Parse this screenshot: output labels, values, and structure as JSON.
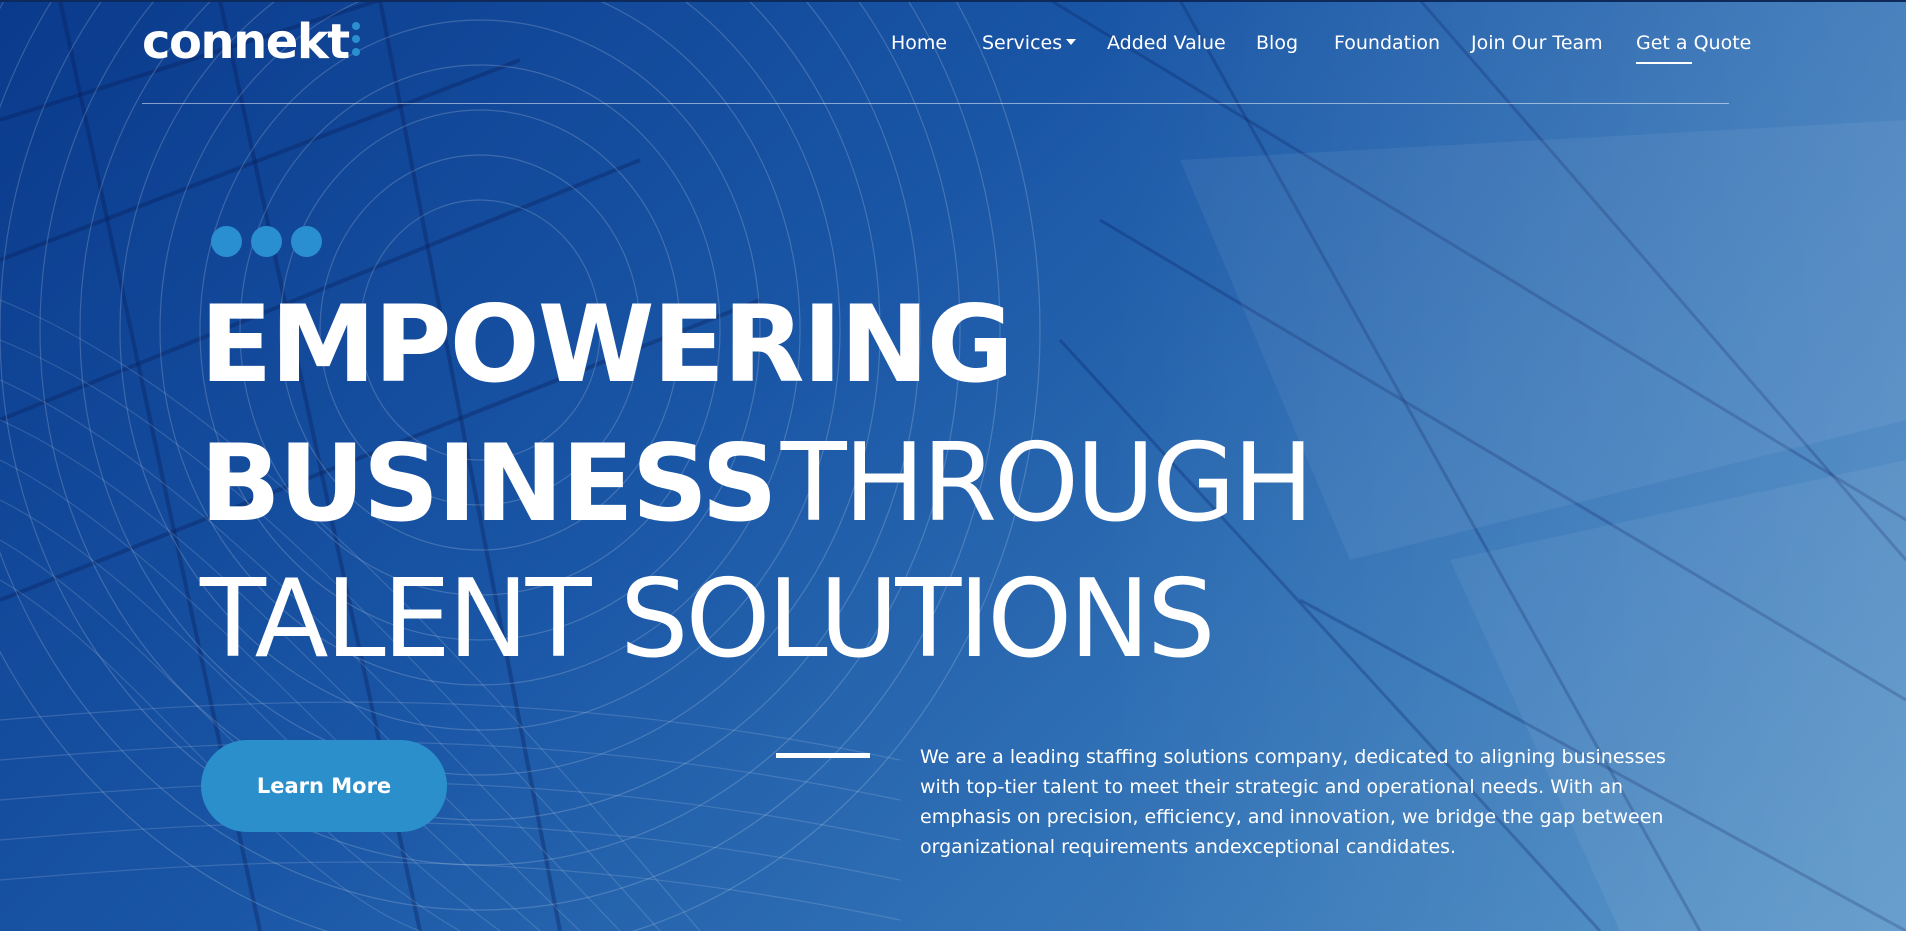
{
  "header": {
    "logo_text": "connekt",
    "nav": [
      {
        "label": "Home"
      },
      {
        "label": "Services"
      },
      {
        "label": "Added Value"
      },
      {
        "label": "Blog"
      },
      {
        "label": "Foundation"
      },
      {
        "label": "Join Our Team"
      },
      {
        "label": "Get a Quote"
      }
    ]
  },
  "hero": {
    "line1_bold": "EMPOWERING",
    "line2_bold": "BUSINESS",
    "line2_light": "THROUGH",
    "line3_light": "TALENT SOLUTIONS",
    "cta_label": "Learn More",
    "description": "We are a leading staffing solutions company, dedicated to aligning businesses with top-tier talent to meet their strategic and operational needs. With an emphasis on precision, efficiency, and innovation, we bridge the gap between organizational requirements andexceptional candidates."
  },
  "colors": {
    "accent": "#2b8fcb",
    "background_dark": "#0a3a8c",
    "background_light": "#4a8cc4",
    "text": "#ffffff"
  }
}
